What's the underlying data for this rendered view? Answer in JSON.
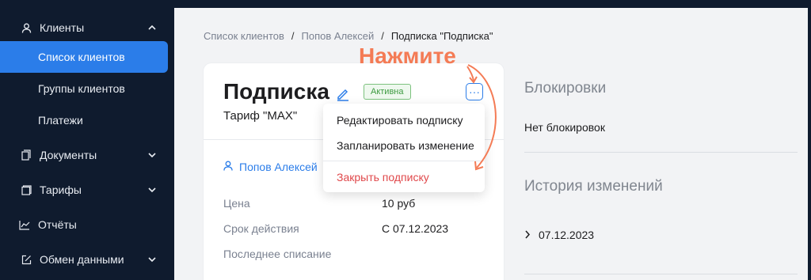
{
  "sidebar": {
    "section_clients": "Клиенты",
    "sub_items": [
      "Список клиентов",
      "Группы клиентов",
      "Платежи"
    ],
    "active_sub_index": 0,
    "items": [
      "Документы",
      "Тарифы",
      "Отчёты",
      "Обмен данными"
    ]
  },
  "breadcrumb": {
    "items": [
      "Список клиентов",
      "Попов Алексей"
    ],
    "separator": "/",
    "current": "Подписка \"Подписка\""
  },
  "card": {
    "title": "Подписка",
    "status": "Активна",
    "more_label": "···",
    "plan": "Тариф \"MAX\"",
    "client": "Попов Алексей",
    "fields": [
      {
        "label": "Цена",
        "value": "10 руб"
      },
      {
        "label": "Срок действия",
        "value": "С 07.12.2023"
      },
      {
        "label": "Последнее списание",
        "value": ""
      }
    ]
  },
  "menu": {
    "items": [
      "Редактировать подписку",
      "Запланировать изменение"
    ],
    "danger_item": "Закрыть подписку"
  },
  "right": {
    "blocks_title": "Блокировки",
    "no_blocks": "Нет блокировок",
    "history_title": "История изменений",
    "history_date": "07.12.2023"
  },
  "annotation": {
    "text": "Нажмите"
  },
  "colors": {
    "sidebar_bg": "#0f1b2e",
    "accent": "#2b7de9",
    "annotation": "#f47b55",
    "danger": "#e0484b",
    "success": "#3d9a40"
  }
}
